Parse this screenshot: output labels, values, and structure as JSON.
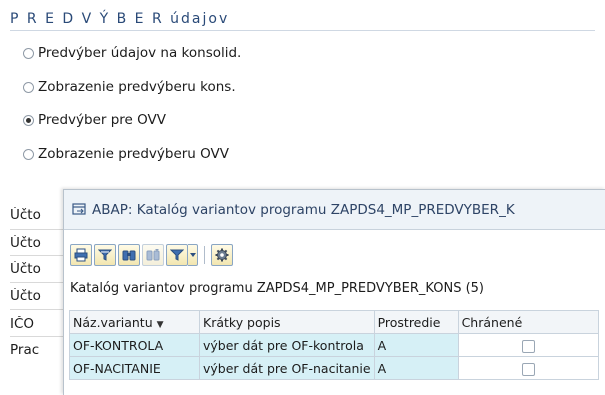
{
  "screen": {
    "section_title": "P R E D V Ý B E R  údajov",
    "radio_options": [
      {
        "label": "Predvýber údajov na konsolid.",
        "selected": false
      },
      {
        "label": "Zobrazenie predvýberu kons.",
        "selected": false
      },
      {
        "label": "Predvýber pre OVV",
        "selected": true
      },
      {
        "label": "Zobrazenie predvýberu OVV",
        "selected": false
      }
    ],
    "field_labels": [
      "Účto",
      "Účto",
      "Účto",
      "Účto",
      "IČO",
      "Prac"
    ]
  },
  "dialog": {
    "title": "ABAP: Katalóg variantov programu ZAPDS4_MP_PREDVYBER_K",
    "toolbar": [
      "print-icon",
      "filter-icon",
      "find-icon",
      "find-next-icon",
      "set-filter-icon",
      "settings-icon"
    ],
    "caption": "Katalóg variantov programu ZAPDS4_MP_PREDVYBER_KONS (5)",
    "columns": [
      "Náz.variantu",
      "Krátky popis",
      "Prostredie",
      "Chránené"
    ],
    "rows": [
      {
        "name": "OF-KONTROLA",
        "description": "výber dát pre OF-kontrola",
        "environment": "A",
        "protected": false
      },
      {
        "name": "OF-NACITANIE",
        "description": "výber dát pre OF-nacitanie",
        "environment": "A",
        "protected": false
      }
    ]
  },
  "colors": {
    "title_text": "#2a4a78",
    "key_cell": "#d6f0f6",
    "dialog_header": "#eef3f8"
  }
}
